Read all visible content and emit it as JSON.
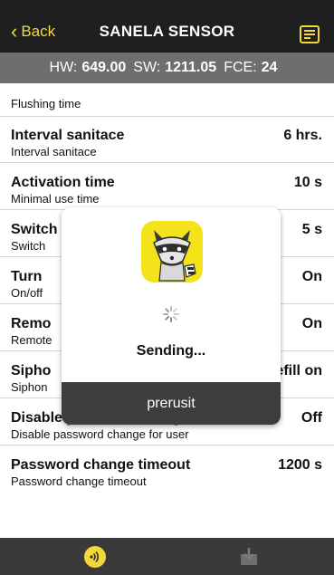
{
  "header": {
    "back_label": "Back",
    "title": "SANELA SENSOR",
    "accent": "#f4d83a"
  },
  "info": {
    "hw_label": "HW:",
    "hw_value": "649.00",
    "sw_label": "SW:",
    "sw_value": "1211.05",
    "fce_label": "FCE:",
    "fce_value": "24"
  },
  "settings": [
    {
      "name": "",
      "desc": "Flushing time",
      "value": ""
    },
    {
      "name": "Interval sanitace",
      "desc": "Interval sanitace",
      "value": "6 hrs."
    },
    {
      "name": "Activation time",
      "desc": "Minimal use time",
      "value": "10 s"
    },
    {
      "name": "Switch",
      "desc": "Switch",
      "value": "5 s"
    },
    {
      "name": "Turn",
      "desc": "On/off",
      "value": "On"
    },
    {
      "name": "Remo",
      "desc": "Remote",
      "value": "On"
    },
    {
      "name": "Sipho",
      "desc": "Siphon",
      "value": "efill on"
    },
    {
      "name": "Disable password change",
      "desc": "Disable password change for user",
      "value": "Off"
    },
    {
      "name": "Password change timeout",
      "desc": "Password change timeout",
      "value": "1200 s"
    }
  ],
  "dialog": {
    "status": "Sending...",
    "cancel_label": "prerusit"
  },
  "icons": {
    "menu": "list-icon",
    "logo": "raccoon-logo-icon",
    "spinner": "spinner-icon",
    "nfc": "nfc-icon",
    "download": "download-icon"
  }
}
